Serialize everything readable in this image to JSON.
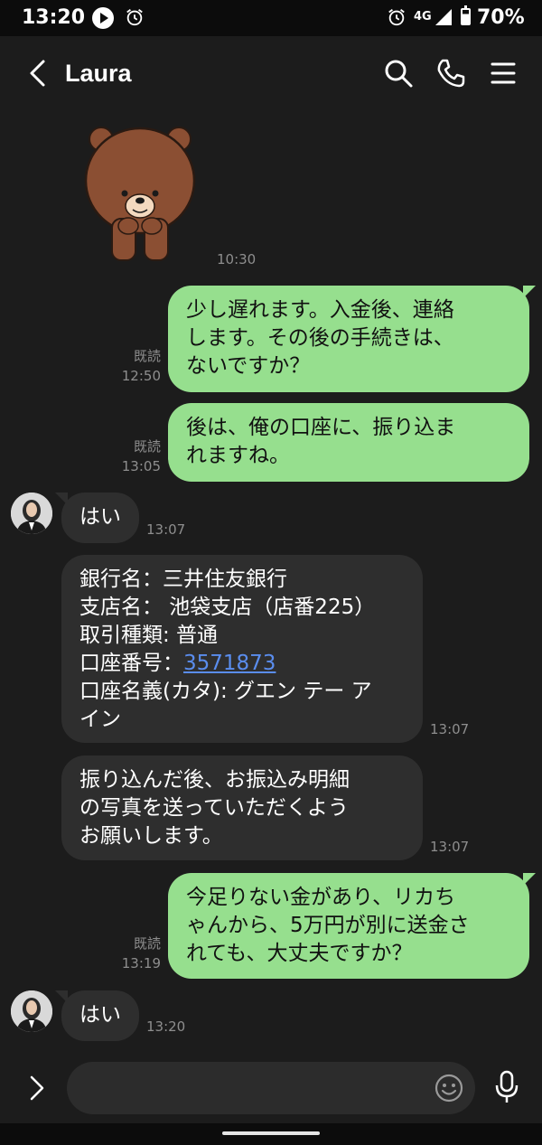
{
  "status_bar": {
    "time": "13:20",
    "network": "4G",
    "battery": "70%",
    "battery_level": 0.7
  },
  "header": {
    "contact_name": "Laura",
    "icons": [
      "back-icon",
      "search-icon",
      "phone-icon",
      "menu-icon"
    ]
  },
  "messages": [
    {
      "type": "sticker",
      "from": "them",
      "sticker": "bear-sticker",
      "time": "10:30"
    },
    {
      "type": "text",
      "from": "me",
      "read": "既読",
      "time": "12:50",
      "lines": [
        "少し遅れます。入金後、連絡",
        "します。その後の手続きは、",
        "ないですか？"
      ]
    },
    {
      "type": "text",
      "from": "me",
      "read": "既読",
      "time": "13:05",
      "lines": [
        "後は、俺の口座に、振り込ま",
        "れますね。"
      ]
    },
    {
      "type": "text",
      "from": "them",
      "time": "13:07",
      "lines": [
        "はい"
      ]
    },
    {
      "type": "text",
      "from": "them",
      "time": "13:07",
      "lines": [
        "銀行名：三井住友銀行",
        "支店名： 池袋支店（店番225）",
        "取引種類: 普通",
        "口座番号：",
        "口座名義(カタ): グエン テー ア",
        "イン"
      ],
      "link": "3571873"
    },
    {
      "type": "text",
      "from": "them",
      "time": "13:07",
      "lines": [
        "振り込んだ後、お振込み明細",
        "の写真を送っていただくよう",
        "お願いします。"
      ]
    },
    {
      "type": "text",
      "from": "me",
      "read": "既読",
      "time": "13:19",
      "lines": [
        "今足りない金があり、リカち",
        "ゃんから、5万円が別に送金さ",
        "れても、大丈夫ですか？"
      ]
    },
    {
      "type": "text",
      "from": "them",
      "time": "13:20",
      "lines": [
        "はい"
      ]
    }
  ],
  "input": {
    "placeholder": "",
    "icons": [
      "chevron-right-icon",
      "emoji-icon",
      "microphone-icon"
    ]
  },
  "colors": {
    "background": "#1c1c1c",
    "outgoing_bubble": "#96df8e",
    "incoming_bubble": "#2e2e2e",
    "link": "#5a8dee"
  }
}
